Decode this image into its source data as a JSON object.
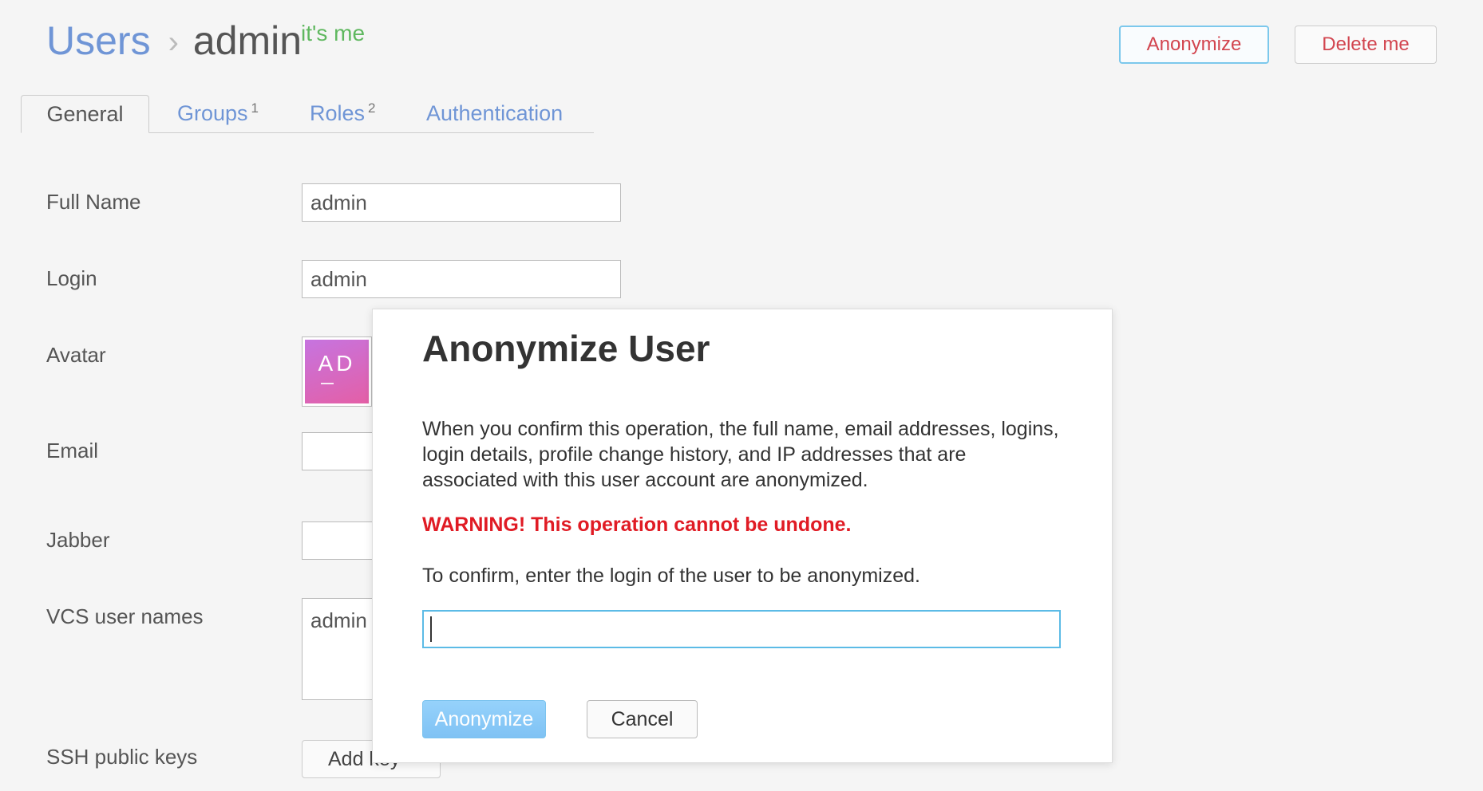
{
  "header": {
    "breadcrumb_root": "Users",
    "breadcrumb_separator": "›",
    "breadcrumb_current": "admin",
    "self_badge": "it's me",
    "anonymize_label": "Anonymize",
    "delete_label": "Delete me"
  },
  "tabs": [
    {
      "label": "General",
      "count": ""
    },
    {
      "label": "Groups",
      "count": "1"
    },
    {
      "label": "Roles",
      "count": "2"
    },
    {
      "label": "Authentication",
      "count": ""
    }
  ],
  "form": {
    "full_name_label": "Full Name",
    "full_name_value": "admin",
    "login_label": "Login",
    "login_value": "admin",
    "avatar_label": "Avatar",
    "avatar_initials": "AD",
    "email_label": "Email",
    "email_value": "",
    "jabber_label": "Jabber",
    "jabber_value": "",
    "vcs_label": "VCS user names",
    "vcs_value": "admin",
    "ssh_label": "SSH public keys",
    "add_key_label": "Add key"
  },
  "modal": {
    "title": "Anonymize User",
    "description": "When you confirm this operation, the full name, email addresses, logins, login details, profile change history, and IP addresses that are associated with this user account are anonymized.",
    "warning": "WARNING! This operation cannot be undone.",
    "confirm_prompt": "To confirm, enter the login of the user to be anonymized.",
    "input_value": "",
    "confirm_label": "Anonymize",
    "cancel_label": "Cancel"
  },
  "colors": {
    "link": "#6f95d6",
    "danger": "#d2454f",
    "success": "#5fb85f",
    "warning_text": "#e01b24",
    "primary_button": "#7fc2f4",
    "focus_border": "#5cbbe6"
  }
}
